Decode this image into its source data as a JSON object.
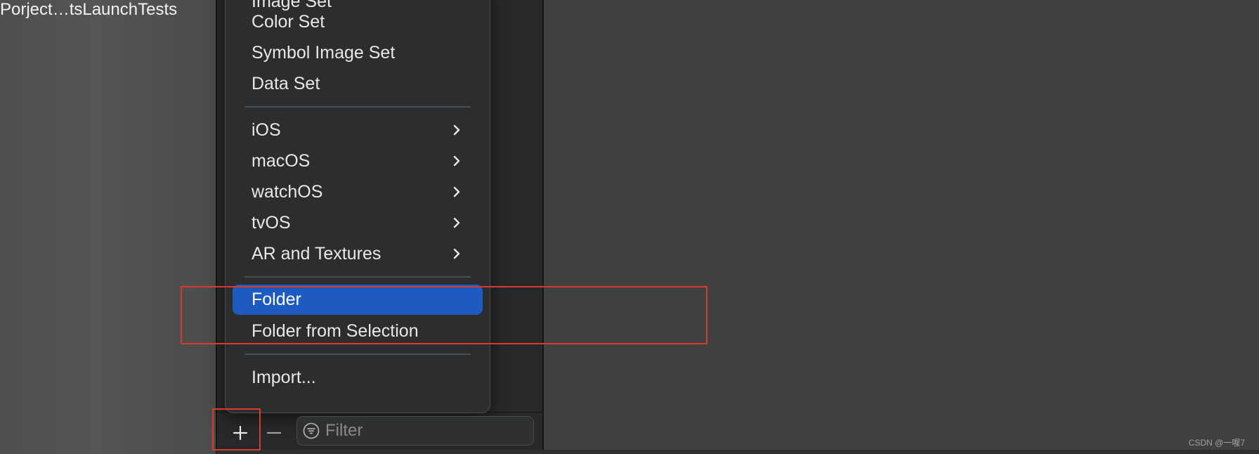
{
  "sidebar": {
    "target_label": "Porject…tsLaunchTests"
  },
  "menu": {
    "items": [
      {
        "label": "Image Set",
        "submenu": false
      },
      {
        "label": "Color Set",
        "submenu": false
      },
      {
        "label": "Symbol Image Set",
        "submenu": false
      },
      {
        "label": "Data Set",
        "submenu": false
      },
      {
        "label": "iOS",
        "submenu": true
      },
      {
        "label": "macOS",
        "submenu": true
      },
      {
        "label": "watchOS",
        "submenu": true
      },
      {
        "label": "tvOS",
        "submenu": true
      },
      {
        "label": "AR and Textures",
        "submenu": true
      },
      {
        "label": "Folder",
        "submenu": false,
        "highlighted": true
      },
      {
        "label": "Folder from Selection",
        "submenu": false
      },
      {
        "label": "Import...",
        "submenu": false
      }
    ],
    "highlight_color": "#1e5bc0"
  },
  "toolbar": {
    "add_icon": "plus-icon",
    "remove_icon": "minus-icon",
    "filter_icon": "filter-icon",
    "filter_placeholder": "Filter"
  },
  "annotations": {
    "color": "#d83a2e"
  },
  "watermark": "CSDN @一喔7"
}
